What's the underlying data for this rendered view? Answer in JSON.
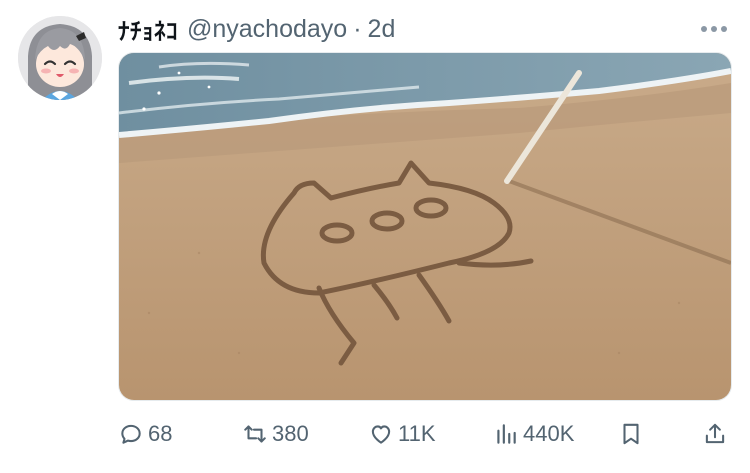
{
  "tweet": {
    "display_name": "ﾅﾁｮﾈｺ",
    "handle": "@nyachodayo",
    "separator": "·",
    "time": "2d",
    "avatar_icon": "anime-girl-avatar",
    "media_description_icon": "beach-sand-cat-drawing-photo",
    "more_icon": "more-horizontal-icon"
  },
  "actions": {
    "replies": {
      "icon": "reply-icon",
      "count": "68"
    },
    "retweets": {
      "icon": "retweet-icon",
      "count": "380"
    },
    "likes": {
      "icon": "like-icon",
      "count": "11K"
    },
    "views": {
      "icon": "views-icon",
      "count": "440K"
    },
    "bookmark": {
      "icon": "bookmark-icon"
    },
    "share": {
      "icon": "share-icon"
    }
  },
  "colors": {
    "text_primary": "#0f1419",
    "text_secondary": "#536471",
    "background": "#ffffff"
  }
}
